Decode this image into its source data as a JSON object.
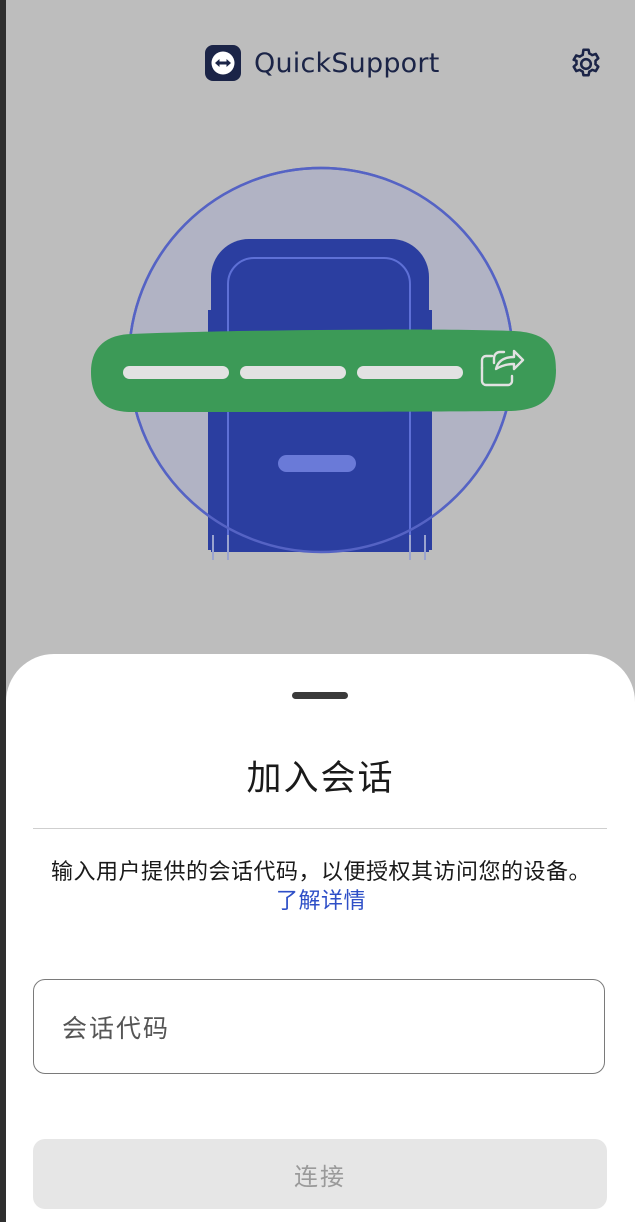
{
  "app": {
    "title": "QuickSupport"
  },
  "icons": {
    "logo": "teamviewer-logo-icon",
    "settings": "gear-icon",
    "share": "share-icon"
  },
  "colors": {
    "navy": "#1b2447",
    "phone_blue": "#2b3ea0",
    "green_bar": "#3c9a57",
    "link": "#2e4fc7"
  },
  "sheet": {
    "title": "加入会话",
    "description": "输入用户提供的会话代码，以便授权其访问您的设备。",
    "learn_more": "了解详情",
    "input_placeholder": "会话代码",
    "connect_label": "连接"
  }
}
